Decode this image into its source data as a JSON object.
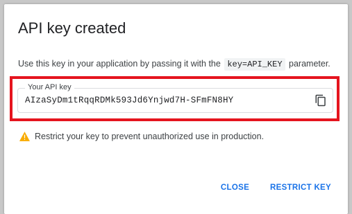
{
  "dialog": {
    "title": "API key created",
    "description_before": "Use this key in your application by passing it with the",
    "description_code": "key=API_KEY",
    "description_after": "parameter.",
    "key_field": {
      "label": "Your API key",
      "value": "AIzaSyDm1tRqqRDMk593Jd6Ynjwd7H-SFmFN8HY",
      "copy_icon": "copy-icon"
    },
    "warning": {
      "icon": "warning-icon",
      "text": "Restrict your key to prevent unauthorized use in production.",
      "icon_color": "#f9ab00"
    },
    "buttons": {
      "close": "CLOSE",
      "restrict": "RESTRICT KEY"
    },
    "colors": {
      "accent": "#1a73e8",
      "highlight": "#e5141e"
    }
  }
}
